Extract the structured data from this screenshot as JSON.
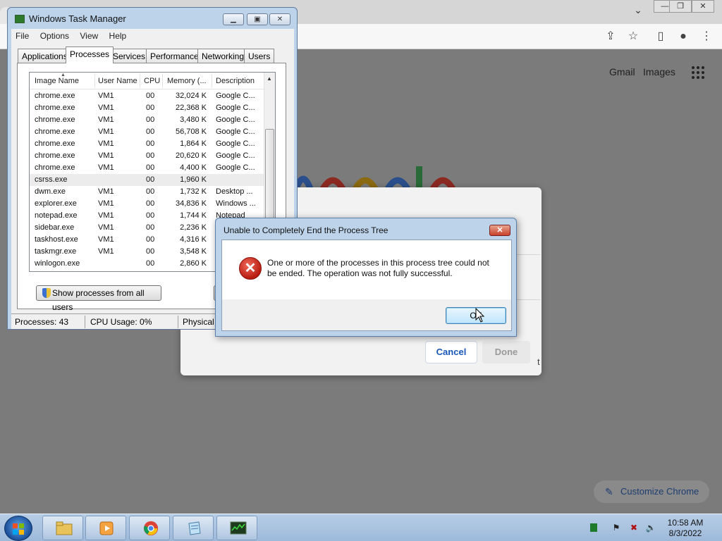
{
  "chrome": {
    "window_controls": [
      "—",
      "❐",
      "✕"
    ],
    "top_links": [
      "Gmail",
      "Images"
    ],
    "customize_label": "Customize Chrome",
    "dialog": {
      "cancel_label": "Cancel",
      "done_label": "Done",
      "trailing_text": "t"
    }
  },
  "task_manager": {
    "title": "Windows Task Manager",
    "menu": [
      "File",
      "Options",
      "View",
      "Help"
    ],
    "tabs": [
      "Applications",
      "Processes",
      "Services",
      "Performance",
      "Networking",
      "Users"
    ],
    "active_tab": "Processes",
    "columns": [
      "Image Name",
      "User Name",
      "CPU",
      "Memory (...",
      "Description"
    ],
    "rows": [
      {
        "image": "chrome.exe",
        "user": "VM1",
        "cpu": "00",
        "mem": "32,024 K",
        "desc": "Google C..."
      },
      {
        "image": "chrome.exe",
        "user": "VM1",
        "cpu": "00",
        "mem": "22,368 K",
        "desc": "Google C..."
      },
      {
        "image": "chrome.exe",
        "user": "VM1",
        "cpu": "00",
        "mem": "3,480 K",
        "desc": "Google C..."
      },
      {
        "image": "chrome.exe",
        "user": "VM1",
        "cpu": "00",
        "mem": "56,708 K",
        "desc": "Google C..."
      },
      {
        "image": "chrome.exe",
        "user": "VM1",
        "cpu": "00",
        "mem": "1,864 K",
        "desc": "Google C..."
      },
      {
        "image": "chrome.exe",
        "user": "VM1",
        "cpu": "00",
        "mem": "20,620 K",
        "desc": "Google C..."
      },
      {
        "image": "chrome.exe",
        "user": "VM1",
        "cpu": "00",
        "mem": "4,400 K",
        "desc": "Google C..."
      },
      {
        "image": "csrss.exe",
        "user": "",
        "cpu": "00",
        "mem": "1,960 K",
        "desc": ""
      },
      {
        "image": "dwm.exe",
        "user": "VM1",
        "cpu": "00",
        "mem": "1,732 K",
        "desc": "Desktop ..."
      },
      {
        "image": "explorer.exe",
        "user": "VM1",
        "cpu": "00",
        "mem": "34,836 K",
        "desc": "Windows ..."
      },
      {
        "image": "notepad.exe",
        "user": "VM1",
        "cpu": "00",
        "mem": "1,744 K",
        "desc": "Notepad"
      },
      {
        "image": "sidebar.exe",
        "user": "VM1",
        "cpu": "00",
        "mem": "2,236 K",
        "desc": ""
      },
      {
        "image": "taskhost.exe",
        "user": "VM1",
        "cpu": "00",
        "mem": "4,316 K",
        "desc": ""
      },
      {
        "image": "taskmgr.exe",
        "user": "VM1",
        "cpu": "00",
        "mem": "3,548 K",
        "desc": ""
      },
      {
        "image": "winlogon.exe",
        "user": "",
        "cpu": "00",
        "mem": "2,860 K",
        "desc": ""
      }
    ],
    "show_all_label": "Show processes from all users",
    "status": {
      "processes": "Processes: 43",
      "cpu": "CPU Usage: 0%",
      "physical": "Physical"
    }
  },
  "error_dialog": {
    "title": "Unable to Completely End the Process Tree",
    "message": "One or more of the processes in this process tree could not be ended.  The operation was not fully successful.",
    "ok_label": "OK"
  },
  "taskbar": {
    "time": "10:58 AM",
    "date": "8/3/2022"
  }
}
